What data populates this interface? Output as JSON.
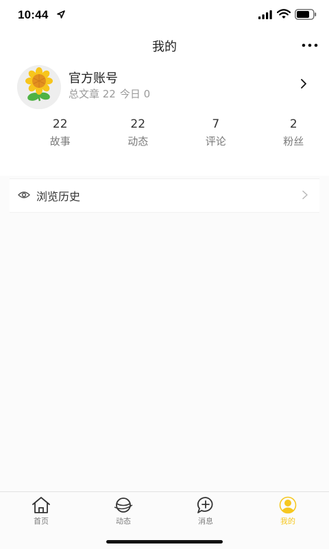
{
  "status_bar": {
    "time": "10:44"
  },
  "nav": {
    "title": "我的"
  },
  "profile": {
    "name": "官方账号",
    "meta_articles": "总文章 22",
    "meta_today": "今日 0"
  },
  "stats": [
    {
      "value": "22",
      "label": "故事"
    },
    {
      "value": "22",
      "label": "动态"
    },
    {
      "value": "7",
      "label": "评论"
    },
    {
      "value": "2",
      "label": "粉丝"
    }
  ],
  "menu": {
    "history_label": "浏览历史"
  },
  "tabs": [
    {
      "label": "首页"
    },
    {
      "label": "动态"
    },
    {
      "label": "消息"
    },
    {
      "label": "我的"
    }
  ],
  "colors": {
    "accent": "#f6c71f",
    "background": "#fbfbfb",
    "muted_text": "#9a9a9a"
  }
}
